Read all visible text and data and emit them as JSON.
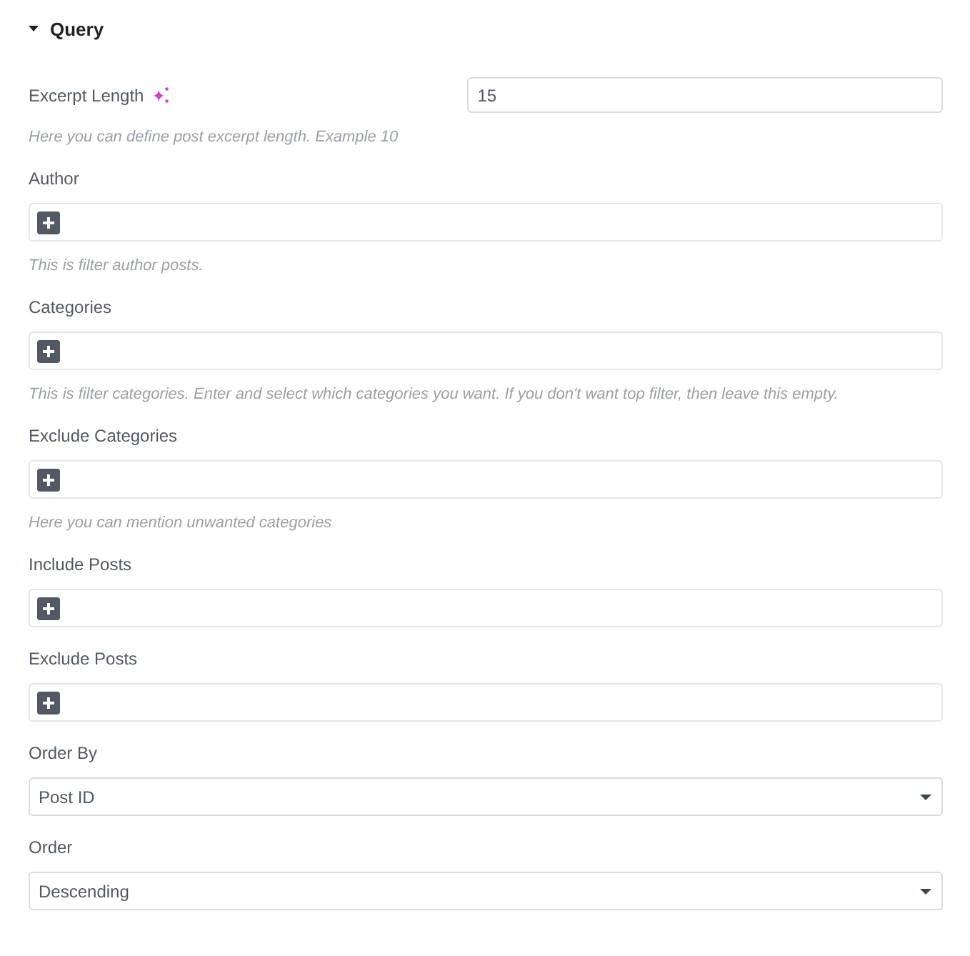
{
  "section": {
    "title": "Query",
    "expanded": true
  },
  "controls": [
    {
      "kind": "number",
      "label": "Excerpt Length",
      "ai_button": true,
      "value": "15",
      "description": "Here you can define post excerpt length. Example 10"
    },
    {
      "kind": "repeater",
      "label": "Author",
      "description": "This is filter author posts."
    },
    {
      "kind": "repeater",
      "label": "Categories",
      "description": "This is filter categories. Enter and select which categories you want. If you don't want top filter, then leave this empty."
    },
    {
      "kind": "repeater",
      "label": "Exclude Categories",
      "description": "Here you can mention unwanted categories"
    },
    {
      "kind": "repeater",
      "label": "Include Posts"
    },
    {
      "kind": "repeater",
      "label": "Exclude Posts"
    },
    {
      "kind": "select",
      "label": "Order By",
      "value": "Post ID"
    },
    {
      "kind": "select",
      "label": "Order",
      "value": "Descending"
    }
  ]
}
